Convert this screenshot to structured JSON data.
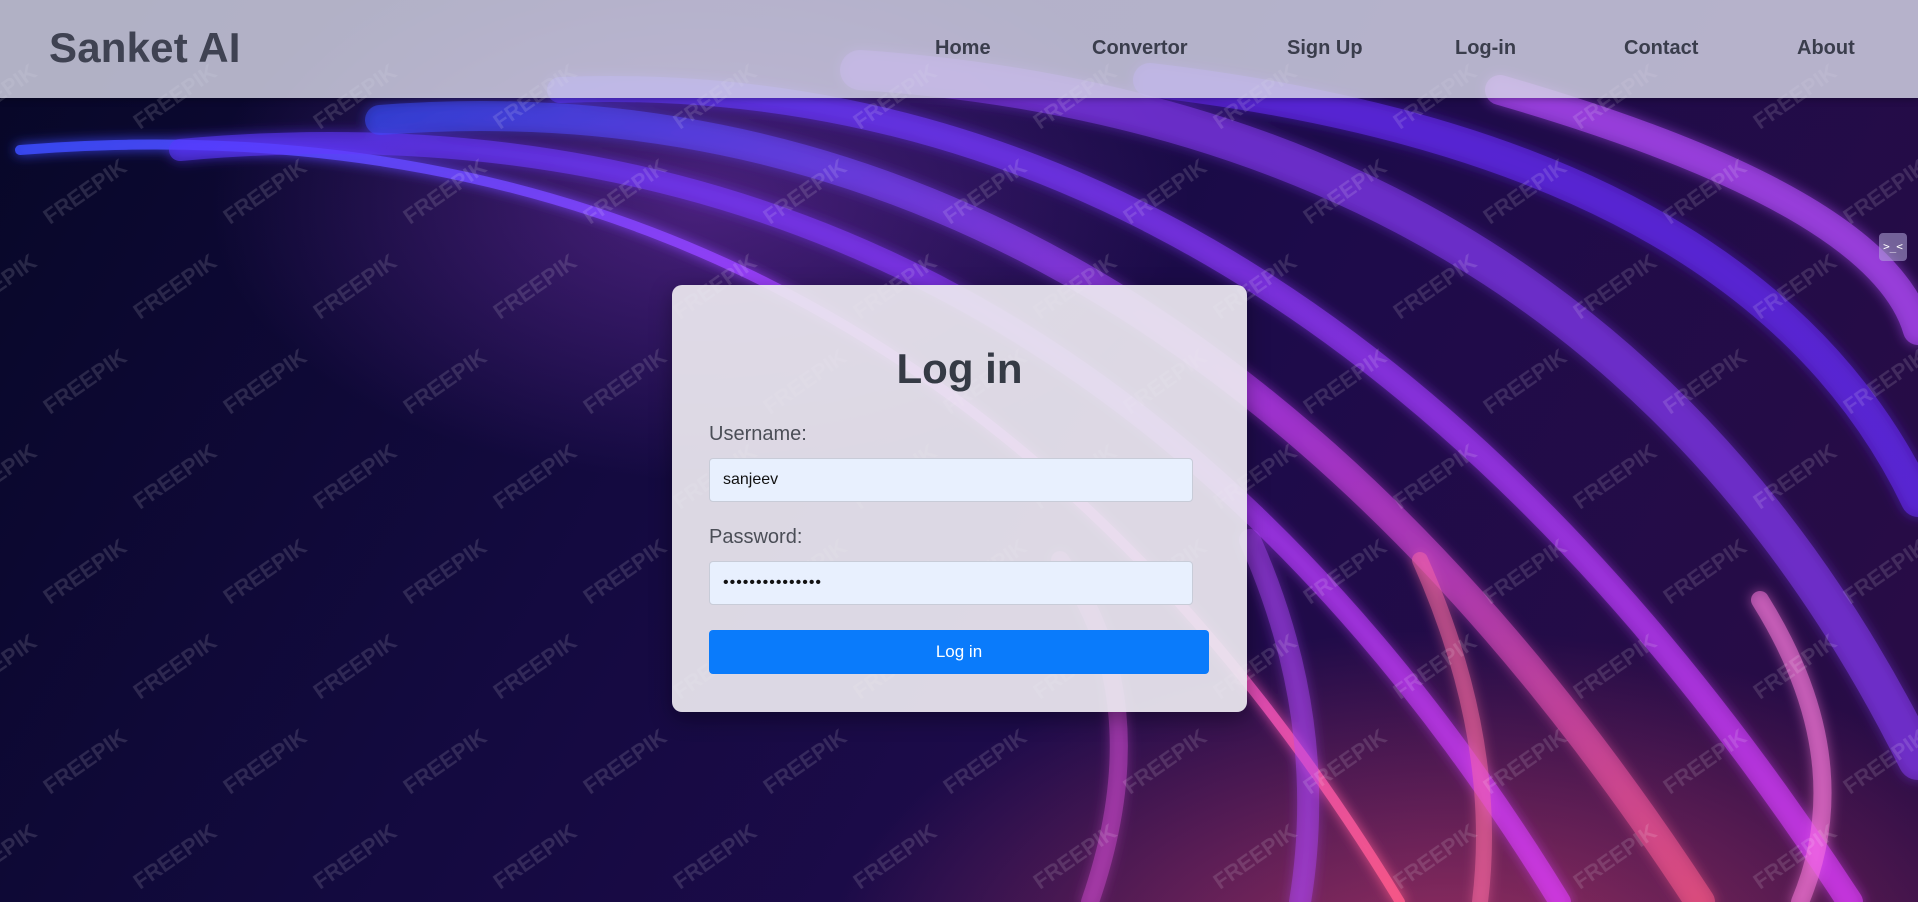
{
  "header": {
    "brand": "Sanket AI",
    "nav": [
      "Home",
      "Convertor",
      "Sign Up",
      "Log-in",
      "Contact",
      "About"
    ]
  },
  "background": {
    "watermark": "FREEPIK",
    "colors": {
      "deep": "#070727",
      "violet": "#7b2cff",
      "magenta": "#e040fb",
      "pink": "#ff5a8a"
    }
  },
  "side_widget": {
    "glyph": ">_<"
  },
  "login_form": {
    "title": "Log in",
    "username_label": "Username:",
    "username_value": "sanjeev",
    "password_label": "Password:",
    "password_value": "•••••••••••••••",
    "submit_label": "Log in",
    "accent": "#0a7bfb"
  }
}
